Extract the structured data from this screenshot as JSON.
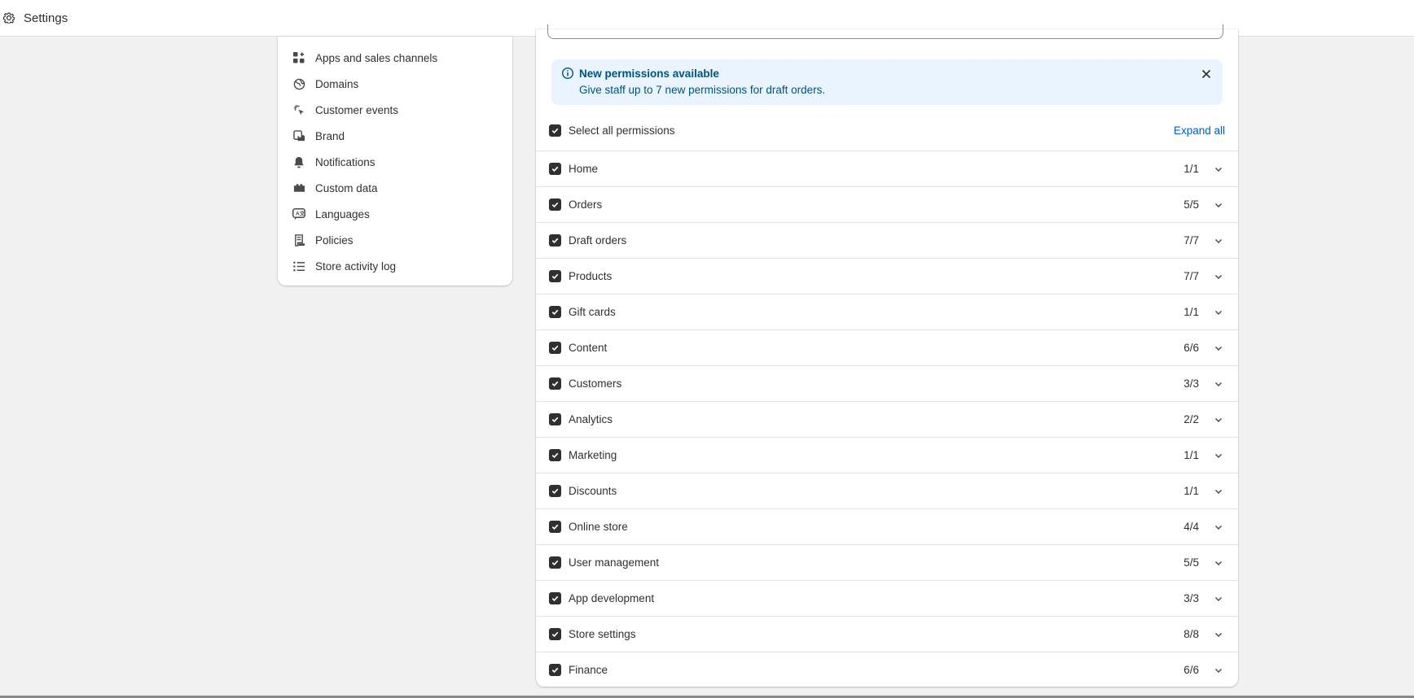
{
  "topbar": {
    "title": "Settings",
    "icon": "gear-icon"
  },
  "sidebar": {
    "items": [
      {
        "label": "Apps and sales channels",
        "icon": "apps-icon"
      },
      {
        "label": "Domains",
        "icon": "globe-icon"
      },
      {
        "label": "Customer events",
        "icon": "cursor-click-icon"
      },
      {
        "label": "Brand",
        "icon": "brand-icon"
      },
      {
        "label": "Notifications",
        "icon": "bell-icon"
      },
      {
        "label": "Custom data",
        "icon": "database-icon"
      },
      {
        "label": "Languages",
        "icon": "language-icon"
      },
      {
        "label": "Policies",
        "icon": "policy-icon"
      },
      {
        "label": "Store activity log",
        "icon": "list-icon"
      }
    ]
  },
  "banner": {
    "title": "New permissions available",
    "text": "Give staff up to 7 new permissions for draft orders.",
    "colors": {
      "background": "#eaf4ff",
      "text": "#00527c"
    }
  },
  "permissions": {
    "select_all_label": "Select all permissions",
    "expand_all_label": "Expand all",
    "items": [
      {
        "label": "Home",
        "count": "1/1"
      },
      {
        "label": "Orders",
        "count": "5/5"
      },
      {
        "label": "Draft orders",
        "count": "7/7"
      },
      {
        "label": "Products",
        "count": "7/7"
      },
      {
        "label": "Gift cards",
        "count": "1/1"
      },
      {
        "label": "Content",
        "count": "6/6"
      },
      {
        "label": "Customers",
        "count": "3/3"
      },
      {
        "label": "Analytics",
        "count": "2/2"
      },
      {
        "label": "Marketing",
        "count": "1/1"
      },
      {
        "label": "Discounts",
        "count": "1/1"
      },
      {
        "label": "Online store",
        "count": "4/4"
      },
      {
        "label": "User management",
        "count": "5/5"
      },
      {
        "label": "App development",
        "count": "3/3"
      },
      {
        "label": "Store settings",
        "count": "8/8"
      },
      {
        "label": "Finance",
        "count": "6/6"
      }
    ]
  },
  "colors": {
    "link": "#005bd3",
    "checkbox": "#303030",
    "page_bg": "#f1f1f1"
  }
}
